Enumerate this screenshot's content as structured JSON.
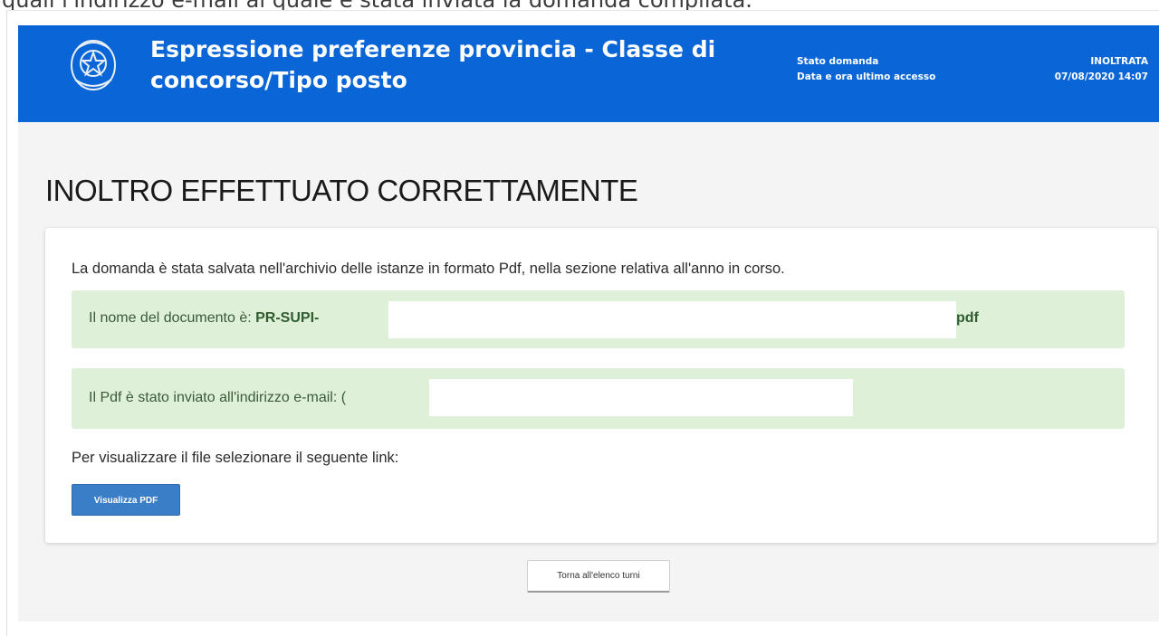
{
  "caption": "quali l'indirizzo e-mail al quale è stata inviata la domanda compilata.",
  "header": {
    "title": "Espressione preferenze provincia - Classe di concorso/Tipo posto",
    "status_label": "Stato domanda",
    "status_value": "INOLTRATA",
    "last_access_label": "Data e ora ultimo accesso",
    "last_access_value": "07/08/2020 14:07",
    "emblem_icon": "italian-republic-emblem-icon",
    "background_color": "#0a66d6"
  },
  "main": {
    "title": "INOLTRO EFFETTUATO CORRETTAMENTE",
    "intro": "La domanda è stata salvata nell'archivio delle istanze in formato Pdf, nella sezione relativa all'anno in corso.",
    "document_name_label": "Il nome del documento è: ",
    "document_name_prefix": "PR-SUPI-",
    "document_name_suffix": "pdf",
    "email_label": "Il Pdf è stato inviato all'indirizzo e-mail: ",
    "email_visible_start": "(",
    "link_hint": "Per visualizzare il file selezionare il seguente link:",
    "view_pdf_button": "Visualizza PDF",
    "back_button": "Torna all'elenco turni",
    "success_color": "#dff0d8",
    "button_color": "#3a7ec8"
  }
}
